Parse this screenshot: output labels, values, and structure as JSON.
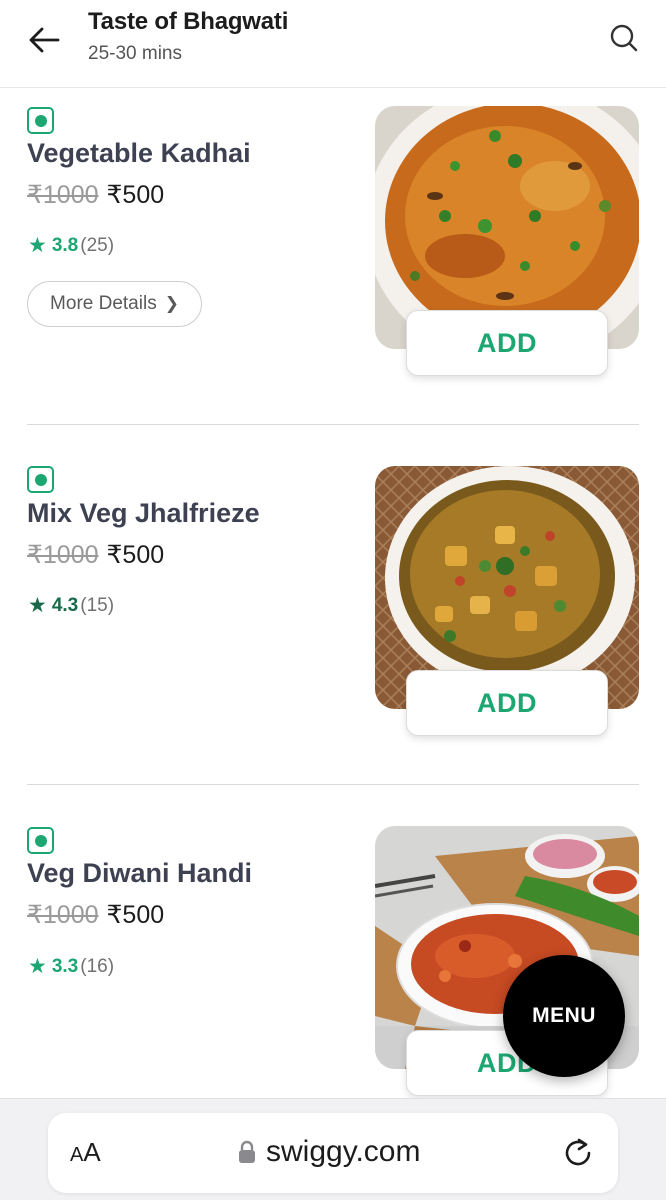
{
  "header": {
    "title": "Taste of Bhagwati",
    "subtitle": "25-30 mins"
  },
  "dishes": [
    {
      "name": "Vegetable Kadhai",
      "old_price": "₹1000",
      "new_price": "₹500",
      "rating": "3.8",
      "rating_count": "(25)",
      "more_details": "More Details",
      "add_label": "ADD"
    },
    {
      "name": "Mix Veg Jhalfrieze",
      "old_price": "₹1000",
      "new_price": "₹500",
      "rating": "4.3",
      "rating_count": "(15)",
      "add_label": "ADD"
    },
    {
      "name": "Veg Diwani Handi",
      "old_price": "₹1000",
      "new_price": "₹500",
      "rating": "3.3",
      "rating_count": "(16)",
      "add_label": "ADD"
    }
  ],
  "menu_button": "MENU",
  "browser": {
    "aa_small": "A",
    "aa_large": "A",
    "url": "swiggy.com"
  },
  "colors": {
    "accent": "#1ba672",
    "text_dark": "#3e4152",
    "fab": "#000000"
  }
}
